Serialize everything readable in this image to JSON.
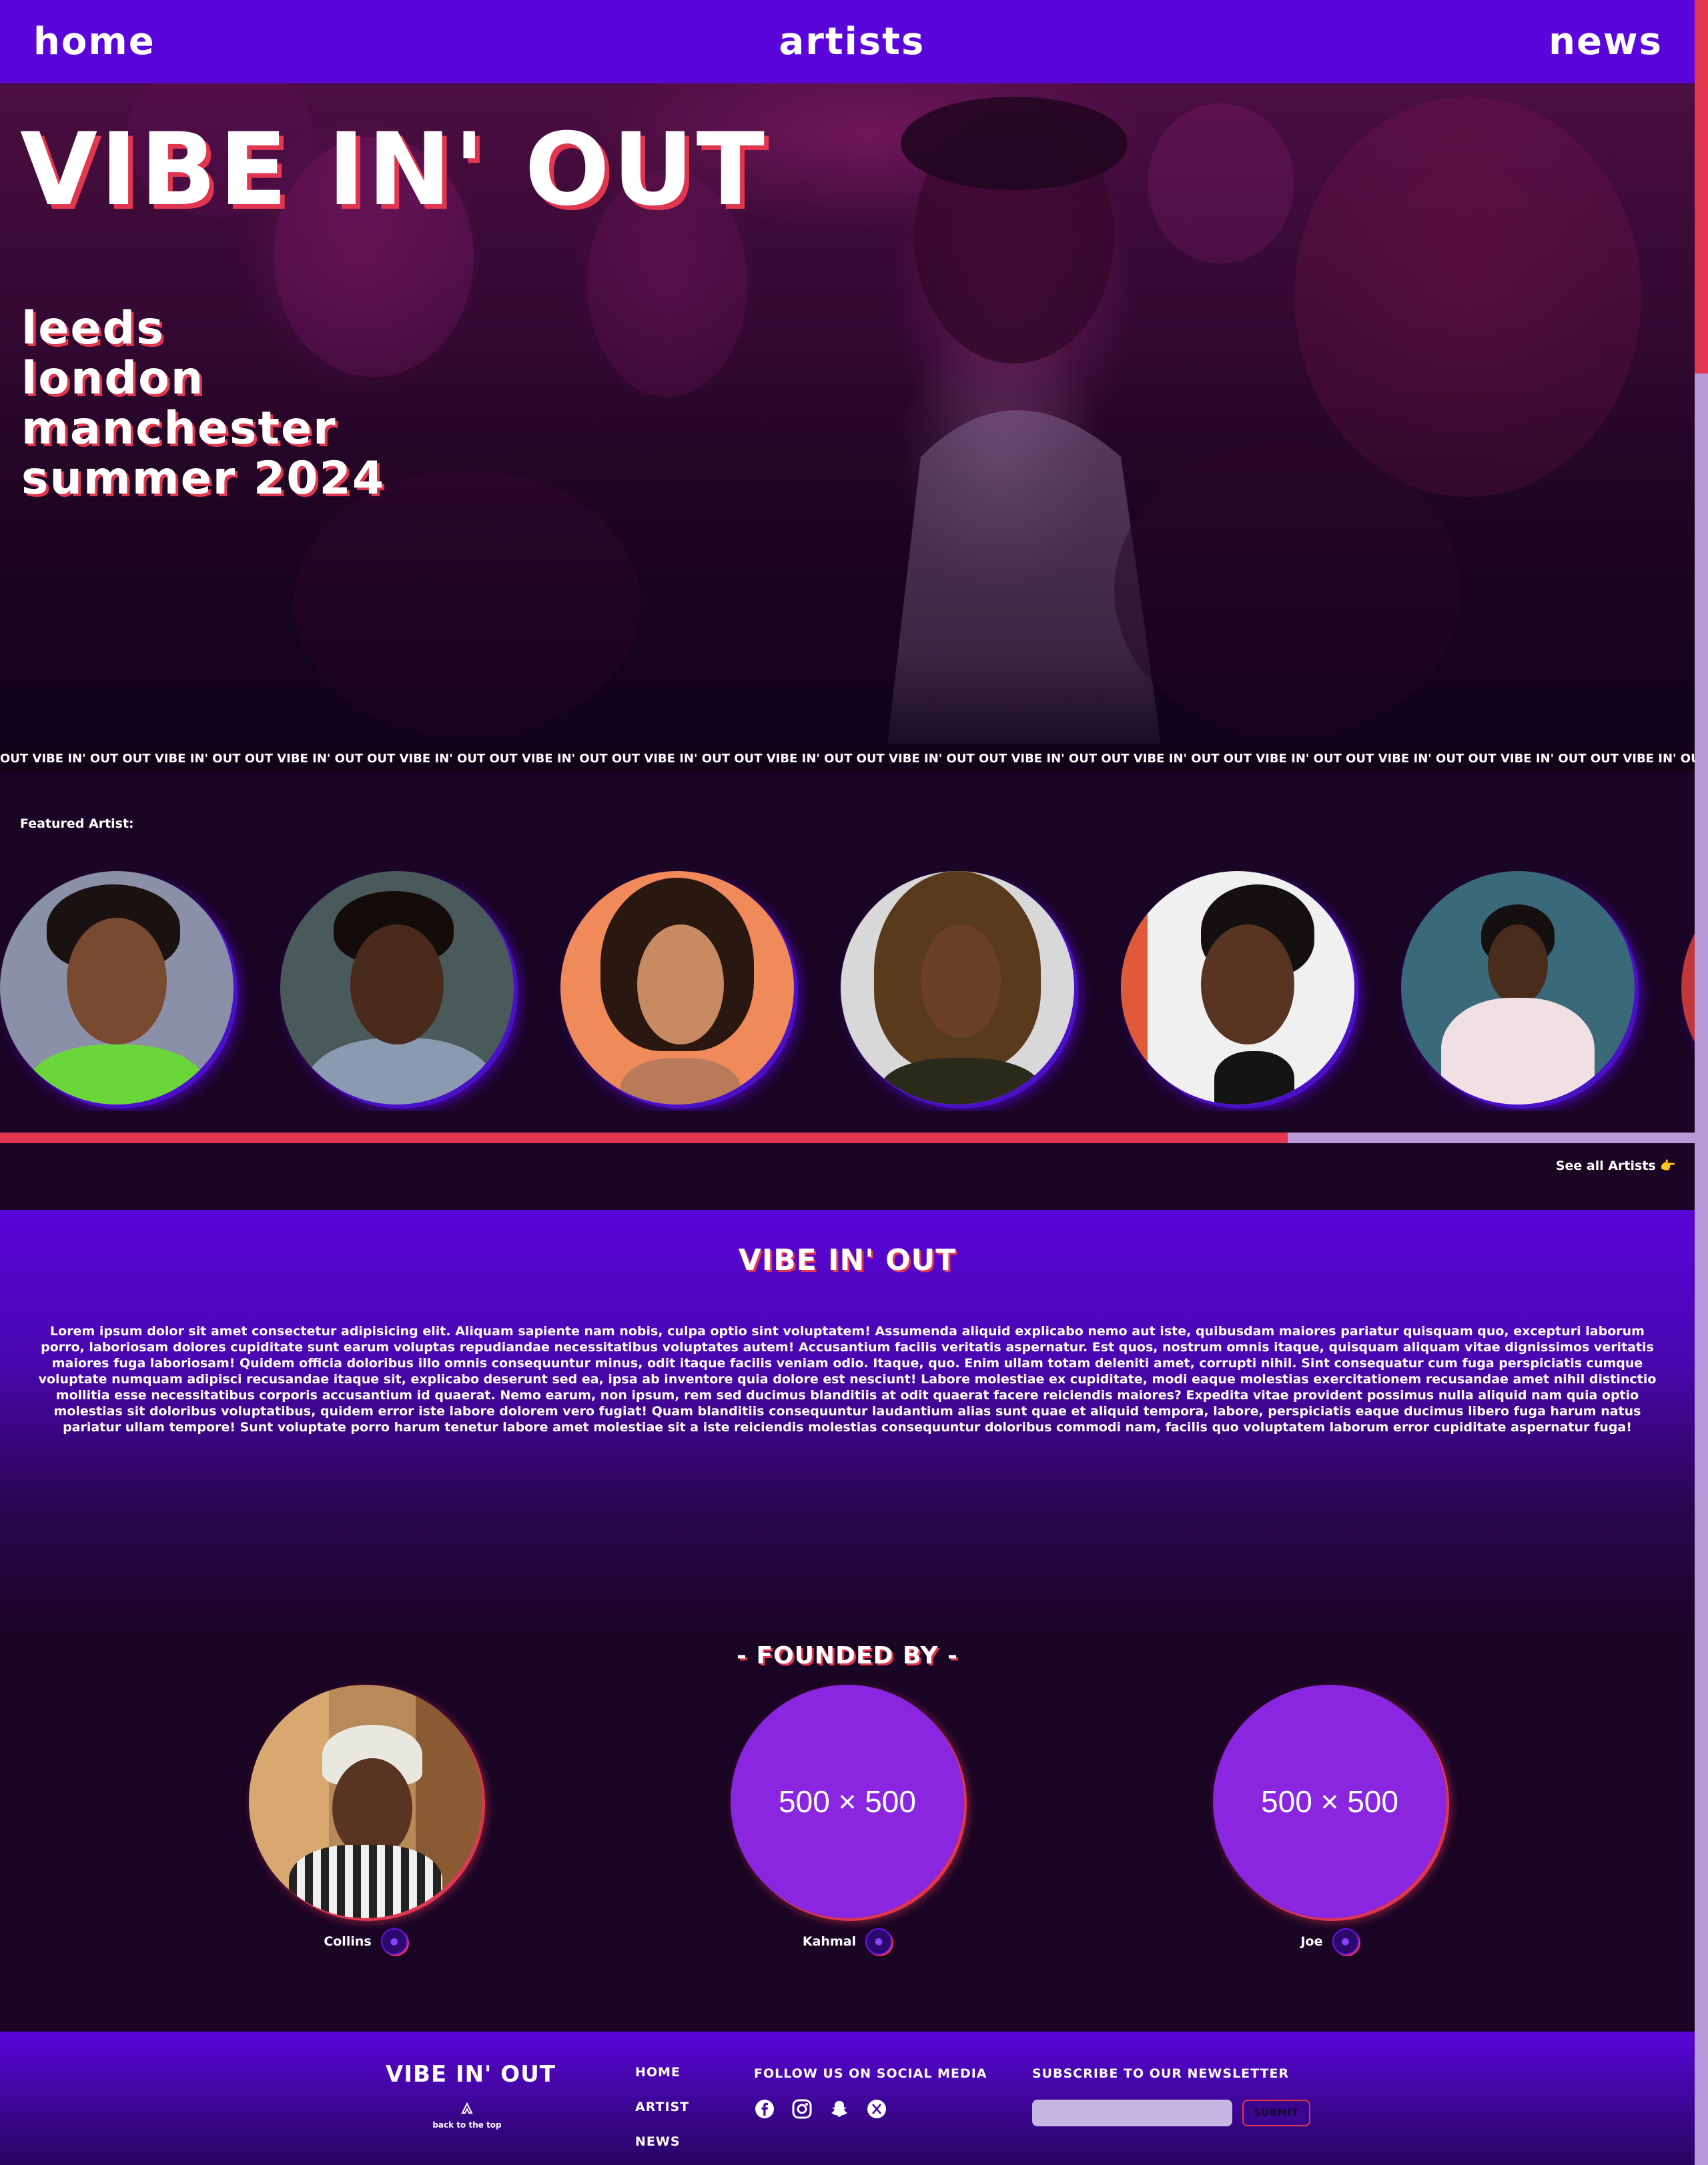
{
  "nav": {
    "home": "home",
    "artists": "artists",
    "news": "news"
  },
  "hero": {
    "title": "VIBE IN' OUT",
    "cities": [
      "leeds",
      "london",
      "manchester",
      "summer 2024"
    ]
  },
  "marquee": {
    "text": "OUT VIBE IN' OUT OUT VIBE IN' OUT OUT VIBE IN' OUT OUT VIBE IN' OUT OUT VIBE IN' OUT OUT VIBE IN' OUT OUT VIBE IN' OUT OUT VIBE IN' OUT OUT VIBE IN' OUT OUT VIBE IN' OUT OUT VIBE IN' OUT OUT VIBE IN' OUT OUT VIBE IN' OUT OUT VIBE IN' OUT OUT VIBE IN' OUT OUT VIBE IN' OUT OUT VIBE IN' OUT OUT VIBE IN' O"
  },
  "featured": {
    "label": "Featured Artist:",
    "see_all": "See all Artists 👉",
    "scroll_progress": 0.76
  },
  "about": {
    "title": "VIBE IN' OUT",
    "text": "Lorem ipsum dolor sit amet consectetur adipisicing elit. Aliquam sapiente nam nobis, culpa optio sint voluptatem! Assumenda aliquid explicabo nemo aut iste, quibusdam maiores pariatur quisquam quo, excepturi laborum porro, laboriosam dolores cupiditate sunt earum voluptas repudiandae necessitatibus voluptates autem! Accusantium facilis veritatis aspernatur. Est quos, nostrum omnis itaque, quisquam aliquam vitae dignissimos veritatis maiores fuga laboriosam! Quidem officia doloribus illo omnis consequuntur minus, odit itaque facilis veniam odio. Itaque, quo. Enim ullam totam deleniti amet, corrupti nihil. Sint consequatur cum fuga perspiciatis cumque voluptate numquam adipisci recusandae itaque sit, explicabo deserunt sed ea, ipsa ab inventore quia dolore est nesciunt! Labore molestiae ex cupiditate, modi eaque molestias exercitationem recusandae amet nihil distinctio mollitia esse necessitatibus corporis accusantium id quaerat. Nemo earum, non ipsum, rem sed ducimus blanditiis at odit quaerat facere reiciendis maiores? Expedita vitae provident possimus nulla aliquid nam quia optio molestias sit doloribus voluptatibus, quidem error iste labore dolorem vero fugiat! Quam blanditiis consequuntur laudantium alias sunt quae et aliquid tempora, labore, perspiciatis eaque ducimus libero fuga harum natus pariatur ullam tempore! Sunt voluptate porro harum tenetur labore amet molestiae sit a iste reiciendis molestias consequuntur doloribus commodi nam, facilis quo voluptatem laborum error cupiditate aspernatur fuga!"
  },
  "founders": {
    "title": "- FOUNDED BY -",
    "items": [
      {
        "name": "Collins",
        "placeholder": ""
      },
      {
        "name": "Kahmal",
        "placeholder": "500 × 500"
      },
      {
        "name": "Joe",
        "placeholder": "500 × 500"
      }
    ]
  },
  "footer": {
    "brand": "VIBE IN' OUT",
    "back_to_top": "back to the top",
    "links": [
      "HOME",
      "ARTIST",
      "NEWS"
    ],
    "social_title": "FOLLOW US ON SOCIAL MEDIA",
    "social_icons": [
      "facebook-icon",
      "instagram-icon",
      "snapchat-icon",
      "x-icon"
    ],
    "newsletter_title": "SUBSCRIBE TO OUR NEWSLETTER",
    "newsletter_placeholder": "",
    "submit_label": "SUBMIT"
  },
  "colors": {
    "nav_purple": "#5a05d9",
    "accent_red": "#e0364f",
    "dark_bg": "#1a0525",
    "placeholder_purple": "#8a26e0",
    "scroll_track": "#b89ad8"
  }
}
